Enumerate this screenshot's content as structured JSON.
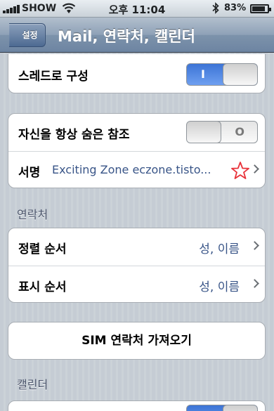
{
  "status_bar": {
    "carrier": "SHOW",
    "time": "오후 11:04",
    "battery_percent": "83%"
  },
  "nav": {
    "back_label": "설정",
    "title": "Mail, 연락처, 캘린더"
  },
  "mail_group": {
    "threaded_label": "스레드로 구성",
    "threaded_toggle": {
      "state": "on",
      "glyph": "I"
    }
  },
  "misc_group": {
    "always_bcc_label": "자신을 항상 숨은 참조",
    "always_bcc_toggle": {
      "state": "off",
      "glyph": "O"
    },
    "signature_label": "서명",
    "signature_value": "Exciting Zone eczone.tisto..."
  },
  "contacts_section": {
    "header": "연락처",
    "sort_order_label": "정렬 순서",
    "sort_order_value": "성, 이름",
    "display_order_label": "표시 순서",
    "display_order_value": "성, 이름"
  },
  "sim_import": {
    "label": "SIM 연락처 가져오기"
  },
  "calendar_section": {
    "header": "캘린더"
  },
  "colors": {
    "accent_blue": "#3c74d6",
    "value_text": "#385487",
    "star_outline": "#e8323a"
  }
}
